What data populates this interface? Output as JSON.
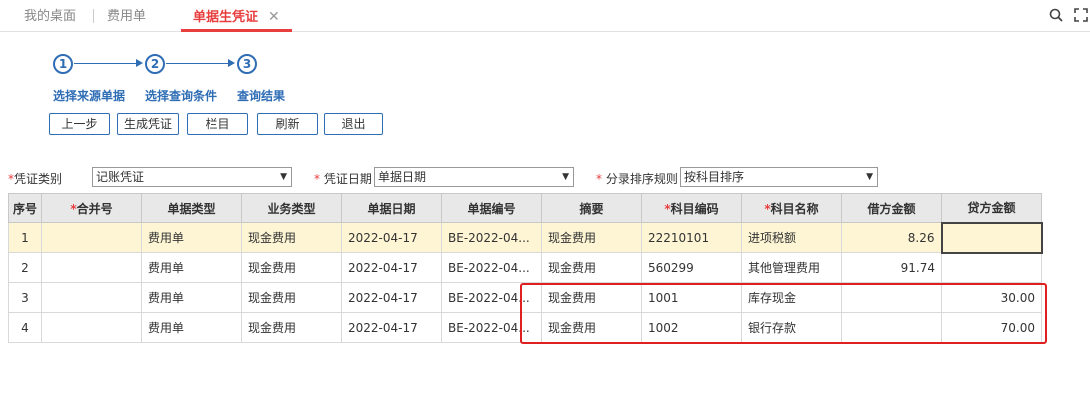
{
  "tabs": [
    {
      "label": "我的桌面"
    },
    {
      "label": "费用单"
    },
    {
      "label": "单据生凭证",
      "close": "✕"
    }
  ],
  "steps": [
    {
      "num": "1",
      "label": "选择来源单据"
    },
    {
      "num": "2",
      "label": "选择查询条件"
    },
    {
      "num": "3",
      "label": "查询结果"
    }
  ],
  "buttons": {
    "prev": "上一步",
    "generate": "生成凭证",
    "columns": "栏目",
    "refresh": "刷新",
    "exit": "退出"
  },
  "filters": {
    "voucher_type": {
      "label": "凭证类别",
      "value": "记账凭证"
    },
    "voucher_date": {
      "label": "凭证日期",
      "value": "单据日期"
    },
    "sort_rule": {
      "label": "分录排序规则",
      "value": "按科目排序"
    }
  },
  "grid": {
    "headers": [
      "序号",
      "合并号",
      "单据类型",
      "业务类型",
      "单据日期",
      "单据编号",
      "摘要",
      "科目编码",
      "科目名称",
      "借方金额",
      "贷方金额"
    ],
    "required_headers": [
      "合并号",
      "科目编码",
      "科目名称"
    ],
    "rows": [
      {
        "seq": "1",
        "merge": "",
        "doc_type": "费用单",
        "biz_type": "现金费用",
        "doc_date": "2022-04-17",
        "doc_no": "BE-2022-04...",
        "summary": "现金费用",
        "acct_code": "22210101",
        "acct_name": "进项税额",
        "debit": "8.26",
        "credit": ""
      },
      {
        "seq": "2",
        "merge": "",
        "doc_type": "费用单",
        "biz_type": "现金费用",
        "doc_date": "2022-04-17",
        "doc_no": "BE-2022-04...",
        "summary": "现金费用",
        "acct_code": "560299",
        "acct_name": "其他管理费用",
        "debit": "91.74",
        "credit": ""
      },
      {
        "seq": "3",
        "merge": "",
        "doc_type": "费用单",
        "biz_type": "现金费用",
        "doc_date": "2022-04-17",
        "doc_no": "BE-2022-04...",
        "summary": "现金费用",
        "acct_code": "1001",
        "acct_name": "库存现金",
        "debit": "",
        "credit": "30.00"
      },
      {
        "seq": "4",
        "merge": "",
        "doc_type": "费用单",
        "biz_type": "现金费用",
        "doc_date": "2022-04-17",
        "doc_no": "BE-2022-04...",
        "summary": "现金费用",
        "acct_code": "1002",
        "acct_name": "银行存款",
        "debit": "",
        "credit": "70.00"
      }
    ]
  },
  "colors": {
    "accent": "#2f6db5",
    "active_tab": "#e83e3e",
    "selected_row": "#fdf5d4",
    "highlight_box": "#e02020"
  }
}
